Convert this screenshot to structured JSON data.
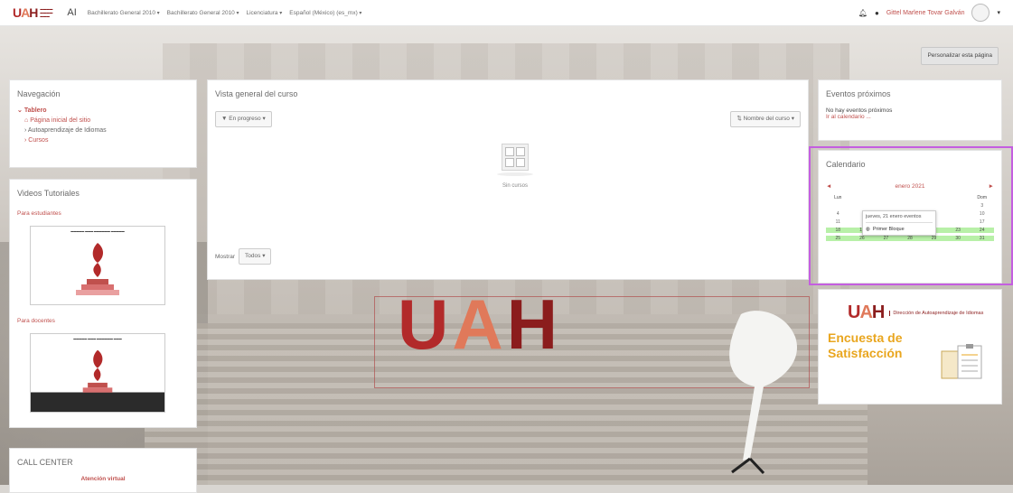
{
  "navbar": {
    "brand_ai": "AI",
    "menu": [
      "Bachillerato General 2010",
      "Bachillerato General 2010",
      "Licenciatura",
      "Español (México) (es_mx)"
    ],
    "user_name": "Gittel Marlene Tovar Galván"
  },
  "customize_button": "Personalizar esta página",
  "navigation": {
    "title": "Navegación",
    "dashboard": "Tablero",
    "home": "Página inicial del sitio",
    "language_learning": "Autoaprendizaje de Idiomas",
    "courses": "Cursos"
  },
  "videos": {
    "title": "Videos Tutoriales",
    "students": "Para estudiantes",
    "teachers": "Para docentes"
  },
  "call_center": {
    "title": "CALL CENTER",
    "virtual": "Atención virtual"
  },
  "course_overview": {
    "title": "Vista general del curso",
    "filter": "En progreso",
    "sort": "Nombre del curso",
    "empty": "Sin cursos",
    "show_label": "Mostrar",
    "show_value": "Todos"
  },
  "events": {
    "title": "Eventos próximos",
    "none": "No hay eventos próximos",
    "link": "Ir al calendario ..."
  },
  "calendar": {
    "title": "Calendario",
    "month": "enero 2021",
    "prev": "◄",
    "next": "►",
    "day_headers": [
      "Lun",
      "",
      "",
      "",
      "",
      "",
      "Dom"
    ],
    "row1": [
      "",
      "",
      "",
      "",
      "",
      "",
      "3"
    ],
    "row2": [
      "4",
      "",
      "",
      "",
      "",
      "",
      "10"
    ],
    "row3": [
      "11",
      "",
      "",
      "",
      "",
      "",
      "17"
    ],
    "row4": [
      "18",
      "19",
      "20",
      "21",
      "22",
      "23",
      "24"
    ],
    "row5": [
      "25",
      "26",
      "27",
      "28",
      "29",
      "30",
      "31"
    ],
    "popup_title": "jueves, 21 enero eventos",
    "popup_event": "Primer Bloque"
  },
  "survey": {
    "logo_text": "Dirección de Autoaprendizaje de Idiomas",
    "line1": "Encuesta de",
    "line2": "Satisfacción"
  },
  "colors": {
    "accent": "#c0504d",
    "calendar_event": "#b8f0a8",
    "highlight": "#c45ee0"
  }
}
